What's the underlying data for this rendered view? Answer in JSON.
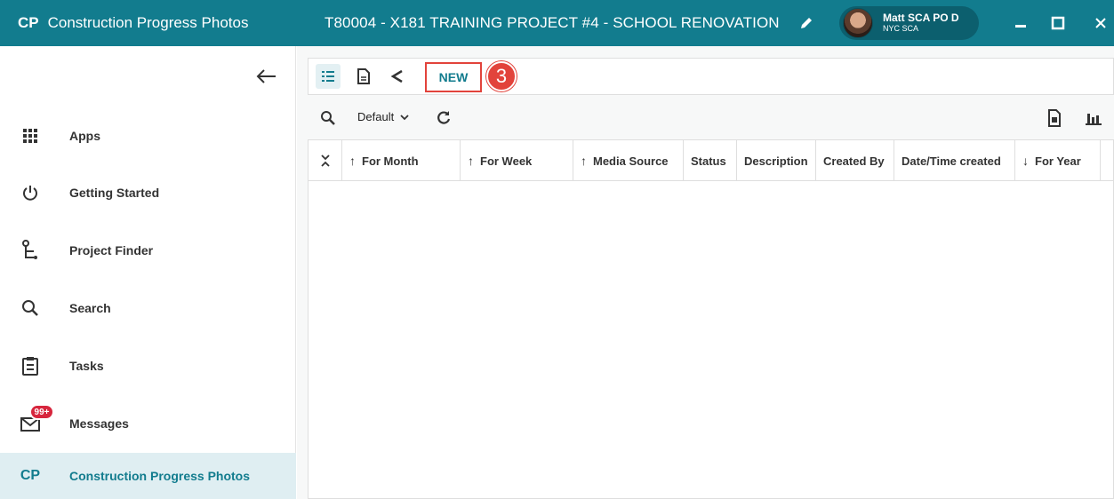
{
  "app": {
    "short": "CP",
    "title": "Construction Progress Photos",
    "project": "T80004 - X181 TRAINING PROJECT #4 - SCHOOL RENOVATION"
  },
  "user": {
    "name": "Matt SCA PO D",
    "org": "NYC SCA"
  },
  "sidebar": {
    "items": [
      {
        "label": "Apps",
        "icon": "apps-grid-icon"
      },
      {
        "label": "Getting Started",
        "icon": "power-icon"
      },
      {
        "label": "Project Finder",
        "icon": "project-tree-icon"
      },
      {
        "label": "Search",
        "icon": "search-icon"
      },
      {
        "label": "Tasks",
        "icon": "clipboard-icon"
      },
      {
        "label": "Messages",
        "icon": "envelope-icon",
        "badge": "99+"
      },
      {
        "label": "Construction Progress Photos",
        "icon": "CP",
        "active": true
      }
    ]
  },
  "toolbar": {
    "new_label": "NEW",
    "callout_number": "3"
  },
  "filter": {
    "view": "Default"
  },
  "grid": {
    "columns": [
      {
        "label": "For Month",
        "sort": "↑"
      },
      {
        "label": "For Week",
        "sort": "↑"
      },
      {
        "label": "Media Source",
        "sort": "↑"
      },
      {
        "label": "Status",
        "sort": ""
      },
      {
        "label": "Description",
        "sort": ""
      },
      {
        "label": "Created By",
        "sort": ""
      },
      {
        "label": "Date/Time created",
        "sort": ""
      },
      {
        "label": "For Year",
        "sort": "↓"
      }
    ],
    "rows": []
  },
  "colors": {
    "brand": "#127c8e",
    "highlight": "#e2433b",
    "badge": "#d7263d"
  }
}
